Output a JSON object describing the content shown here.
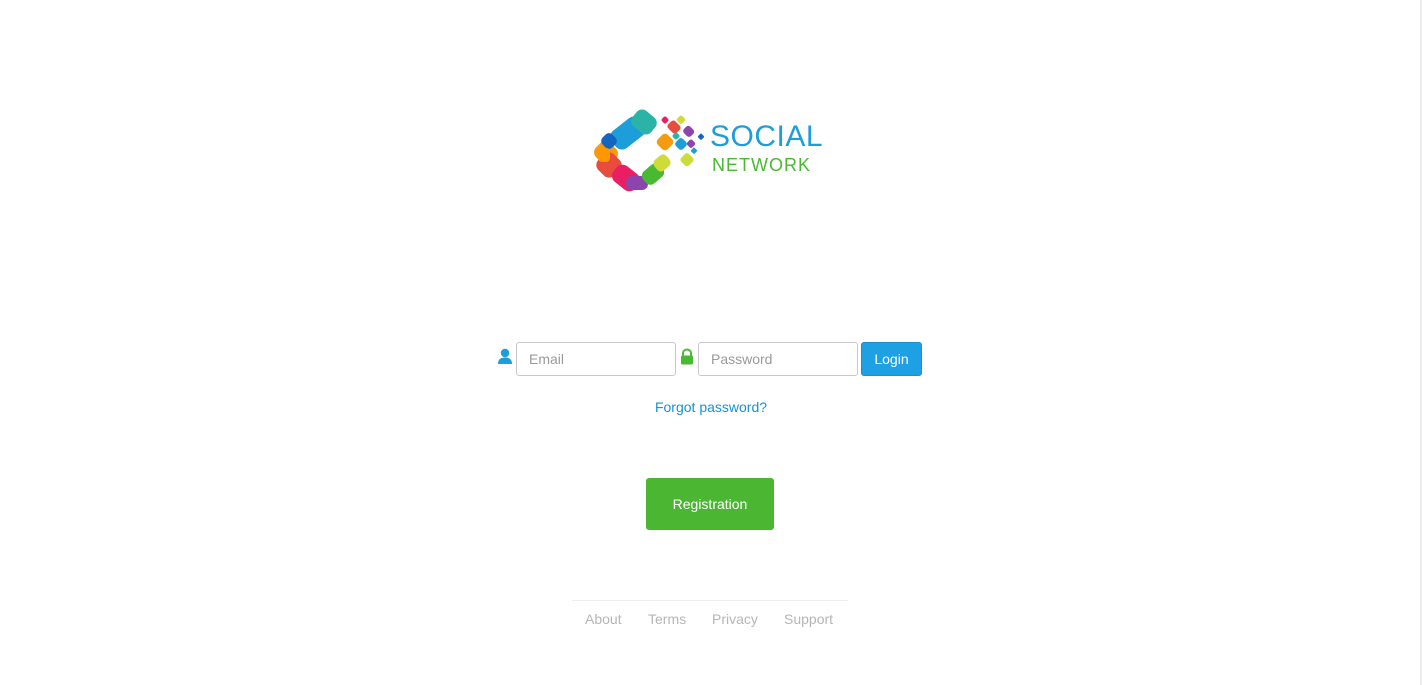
{
  "logo": {
    "line1": "SOCIAL",
    "line2": "NETWORK"
  },
  "login": {
    "email_placeholder": "Email",
    "password_placeholder": "Password",
    "login_label": "Login",
    "forgot_label": "Forgot password?"
  },
  "registration": {
    "label": "Registration"
  },
  "footer": {
    "links": [
      "About",
      "Terms",
      "Privacy",
      "Support"
    ]
  },
  "colors": {
    "primary_blue": "#1ea1e4",
    "registration_green": "#4bb631",
    "logo_blue": "#1e9ed9",
    "logo_green": "#49b934",
    "footer_gray": "#b6b6b6"
  },
  "icons": {
    "email": "user-icon",
    "password": "lock-icon"
  }
}
